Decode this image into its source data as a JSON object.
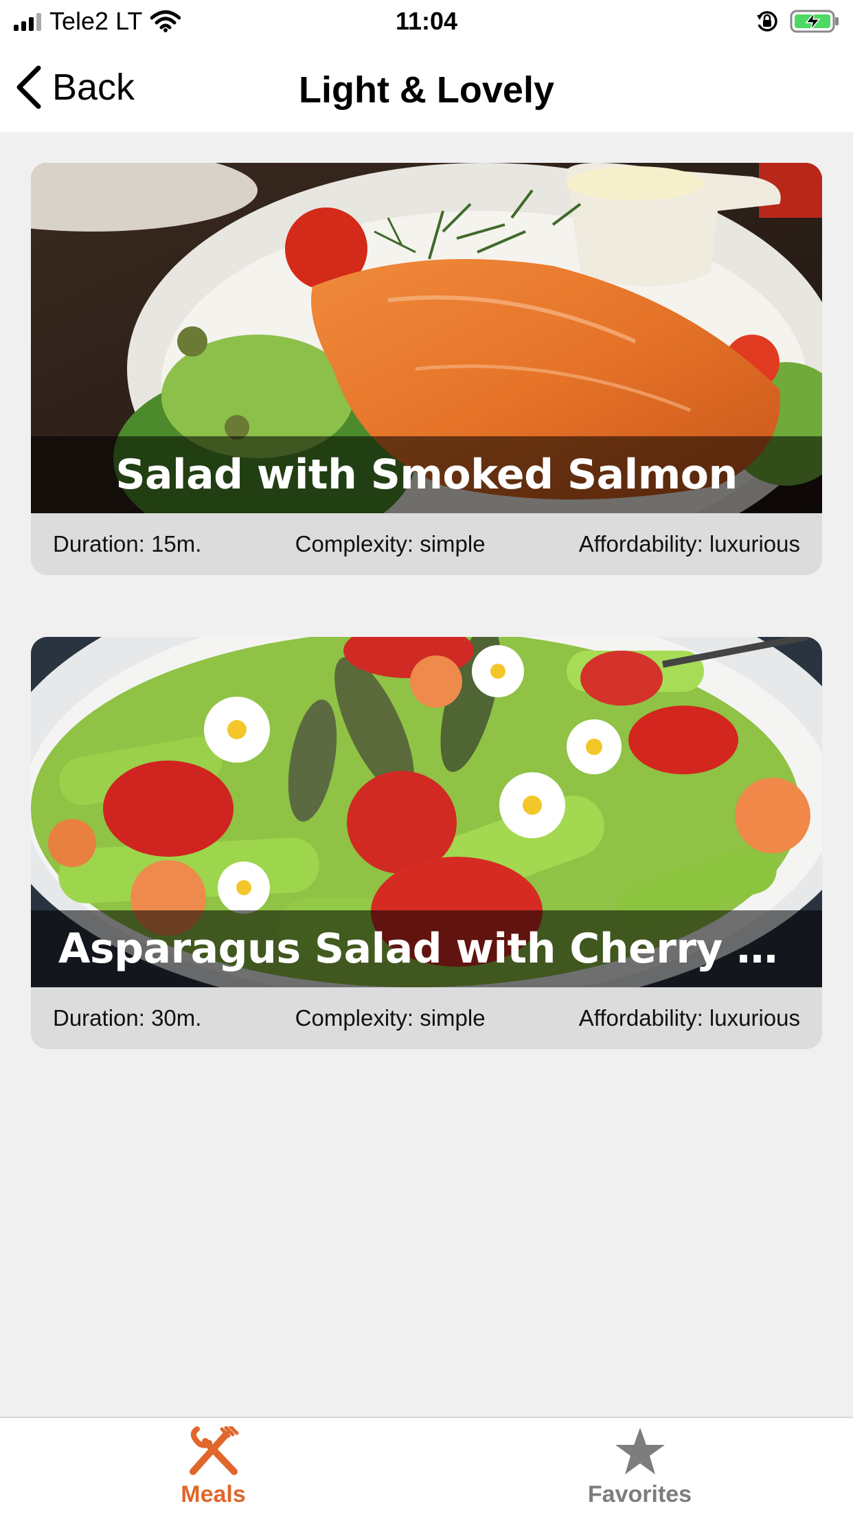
{
  "status_bar": {
    "carrier": "Tele2 LT",
    "time": "11:04"
  },
  "nav": {
    "back_label": "Back",
    "title": "Light & Lovely"
  },
  "meals": [
    {
      "title": "Salad with Smoked Salmon",
      "duration": "Duration: 15m.",
      "complexity": "Complexity: simple",
      "affordability": "Affordability: luxurious"
    },
    {
      "title": "Asparagus Salad with Cherry Tom...",
      "duration": "Duration: 30m.",
      "complexity": "Complexity: simple",
      "affordability": "Affordability: luxurious"
    }
  ],
  "tabs": [
    {
      "label": "Meals",
      "icon": "fork-knife-icon",
      "active": true
    },
    {
      "label": "Favorites",
      "icon": "star-icon",
      "active": false
    }
  ],
  "colors": {
    "accent": "#e0662c",
    "inactive": "#7d7d7d",
    "background": "#f0f0f0",
    "card_details_bg": "#dcdcdc"
  }
}
